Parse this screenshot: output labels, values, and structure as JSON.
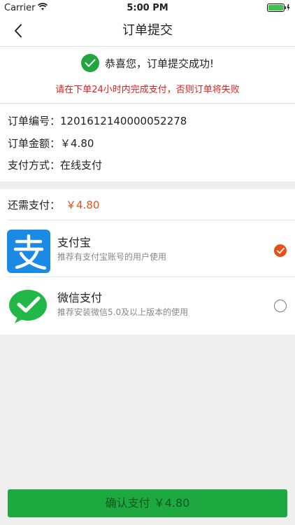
{
  "status_bar": {
    "carrier": "Carrier",
    "time": "5:00 PM"
  },
  "nav": {
    "title": "订单提交"
  },
  "success": {
    "message": "恭喜您，订单提交成功!",
    "warning": "请在下单24小时内完成支付，否则订单将失败"
  },
  "order": {
    "number_label": "订单编号：",
    "number_value": "1201612140000052278",
    "amount_label": "订单金额：",
    "amount_value": "￥4.80",
    "method_label": "支付方式：",
    "method_value": "在线支付"
  },
  "payment": {
    "remaining_label": "还需支付：",
    "remaining_value": "￥4.80",
    "options": [
      {
        "name": "支付宝",
        "desc": "推荐有支付宝账号的用户使用",
        "selected": true
      },
      {
        "name": "微信支付",
        "desc": "推荐安装微信5.0及以上版本的使用",
        "selected": false
      }
    ]
  },
  "confirm": {
    "label": "确认支付 ￥4.80"
  },
  "colors": {
    "green": "#1ea840",
    "orange": "#e8501a",
    "alipay_blue": "#1a8ae5",
    "warning_red": "#e02020"
  }
}
